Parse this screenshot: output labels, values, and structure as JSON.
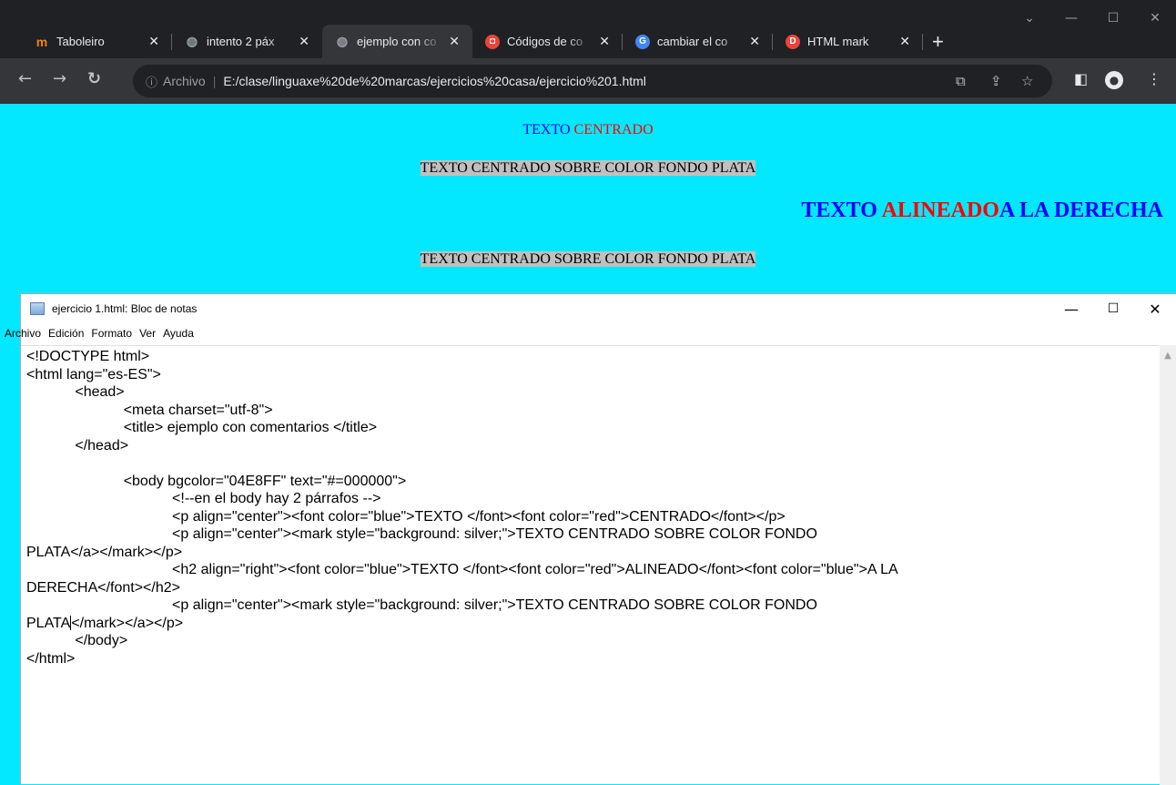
{
  "browser": {
    "tabs": [
      {
        "title": "Taboleiro",
        "favicon": "moodle-icon",
        "favicon_color": "#f98012",
        "active": false
      },
      {
        "title": "intento 2 páx",
        "favicon": "globe-icon",
        "favicon_color": "#9aa0a6",
        "active": false
      },
      {
        "title": "ejemplo con co",
        "favicon": "globe-icon",
        "favicon_color": "#9aa0a6",
        "active": true
      },
      {
        "title": "Códigos de co",
        "favicon": "codes-icon",
        "favicon_color": "#e8453c",
        "active": false
      },
      {
        "title": "cambiar el co",
        "favicon": "google-icon",
        "favicon_color": "#4285f4",
        "active": false
      },
      {
        "title": "HTML mark",
        "favicon": "d-icon",
        "favicon_color": "#e8453c",
        "active": false
      }
    ],
    "address": {
      "scheme_label": "Archivo",
      "url": "E:/clase/linguaxe%20de%20marcas/ejercicios%20casa/ejercicio%201.html"
    }
  },
  "page": {
    "bgcolor": "#04E8FF",
    "p1": {
      "blue": "TEXTO ",
      "red": "CENTRADO"
    },
    "p2": "TEXTO CENTRADO SOBRE COLOR FONDO PLATA",
    "h2": {
      "blue1": "TEXTO ",
      "red": "ALINEADO",
      "blue2": "A LA DERECHA"
    },
    "p3": "TEXTO CENTRADO SOBRE COLOR FONDO PLATA"
  },
  "notepad": {
    "title": "ejercicio 1.html: Bloc de notas",
    "menu": [
      "Archivo",
      "Edición",
      "Formato",
      "Ver",
      "Ayuda"
    ],
    "lines": [
      "<!DOCTYPE html>",
      "<html lang=\"es-ES\">",
      "\t\t<head>",
      "\t\t\t\t<meta charset=\"utf-8\">",
      "\t\t\t\t<title> ejemplo con comentarios </title>",
      "\t\t</head>",
      "",
      "\t\t\t\t<body bgcolor=\"04E8FF\" text=\"#=000000\">",
      "\t\t\t\t\t\t<!--en el body hay 2 párrafos -->",
      "\t\t\t\t\t\t<p align=\"center\"><font color=\"blue\">TEXTO </font><font color=\"red\">CENTRADO</font></p>",
      "\t\t\t\t\t\t<p align=\"center\"><mark style=\"background: silver;\">TEXTO CENTRADO SOBRE COLOR FONDO",
      "PLATA</a></mark></p>",
      "\t\t\t\t\t\t<h2 align=\"right\"><font color=\"blue\">TEXTO </font><font color=\"red\">ALINEADO</font><font color=\"blue\">A LA",
      "DERECHA</font></h2>",
      "\t\t\t\t\t\t<p align=\"center\"><mark style=\"background: silver;\">TEXTO CENTRADO SOBRE COLOR FONDO",
      "PLATA",
      "\t\t</body>",
      "</html>"
    ],
    "line15_rest": "</mark></a></p>"
  }
}
